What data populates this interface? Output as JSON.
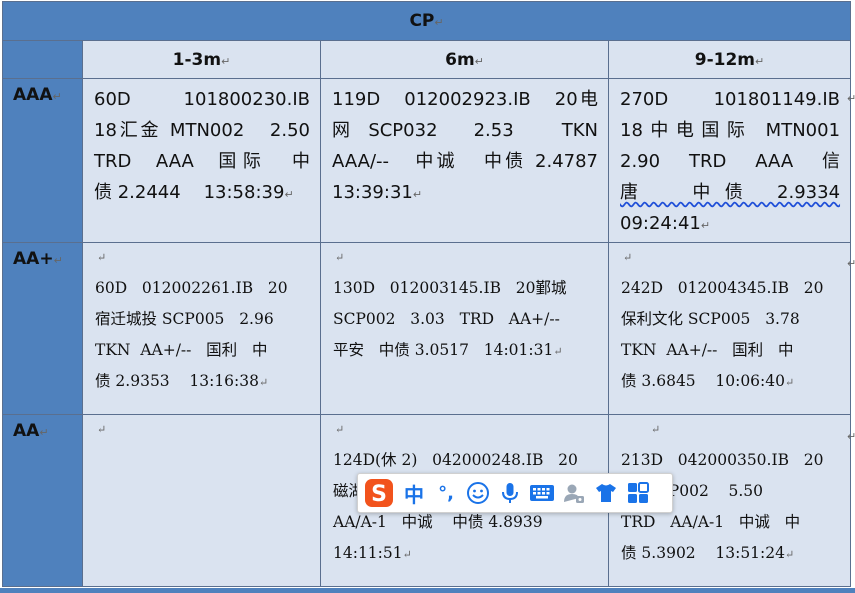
{
  "table": {
    "title": "CP",
    "columns": [
      "1-3m",
      "6m",
      "9-12m"
    ],
    "rows": [
      {
        "rating": "AAA",
        "cells": [
          {
            "lines": [
              "60D   101800230.IB",
              "18汇金 MTN002   2.50",
              "TRD  AAA  国际  中",
              "债 2.2444    13:58:39"
            ]
          },
          {
            "lines": [
              "119D   012002923.IB   20电",
              "网 SCP032   2.53    TKN",
              "AAA/--   中诚   中债 2.4787",
              "13:39:31"
            ]
          },
          {
            "lines": [
              "270D   101801149.IB",
              "18中电国际 MTN001",
              "2.90   TRD   AAA   信",
              "唐  中债 2.9334",
              "09:24:41"
            ]
          }
        ]
      },
      {
        "rating": "AA+",
        "cells": [
          {
            "lines": [
              "60D   012002261.IB   20",
              "宿迁城投 SCP005   2.96",
              "TKN  AA+/--   国利   中",
              "债 2.9353    13:16:38"
            ]
          },
          {
            "lines": [
              "130D   012003145.IB   20鄞城",
              "SCP002   3.03   TRD   AA+/--",
              "平安   中债 3.0517   14:01:31"
            ]
          },
          {
            "lines": [
              "242D   012004345.IB   20",
              "保利文化 SCP005   3.78",
              "TKN  AA+/--   国利   中",
              "债 3.6845    10:06:40"
            ]
          }
        ]
      },
      {
        "rating": "AA",
        "cells": [
          {
            "lines": []
          },
          {
            "lines": [
              "124D(休 2)   042000248.IB   20",
              "磁湖",
              "AA/A-1   中诚    中债 4.8939",
              "14:11:51"
            ]
          },
          {
            "lines": [
              "213D   042000350.IB   20",
              "公用 CP002    5.50",
              "TRD   AA/A-1   中诚   中",
              "债 5.3902    13:51:24"
            ]
          }
        ]
      }
    ]
  },
  "ime_toolbar": {
    "logo": "S",
    "mode": "中",
    "punct": "°,",
    "icons": [
      "emoji-icon",
      "microphone-icon",
      "keyboard-icon",
      "user-settings-icon",
      "skin-shirt-icon",
      "grid-apps-icon"
    ]
  },
  "colors": {
    "header_blue": "#4f81bd",
    "cell_light": "#dae3f0",
    "ime_logo": "#f2531c",
    "ime_icons": "#1a73e8"
  }
}
